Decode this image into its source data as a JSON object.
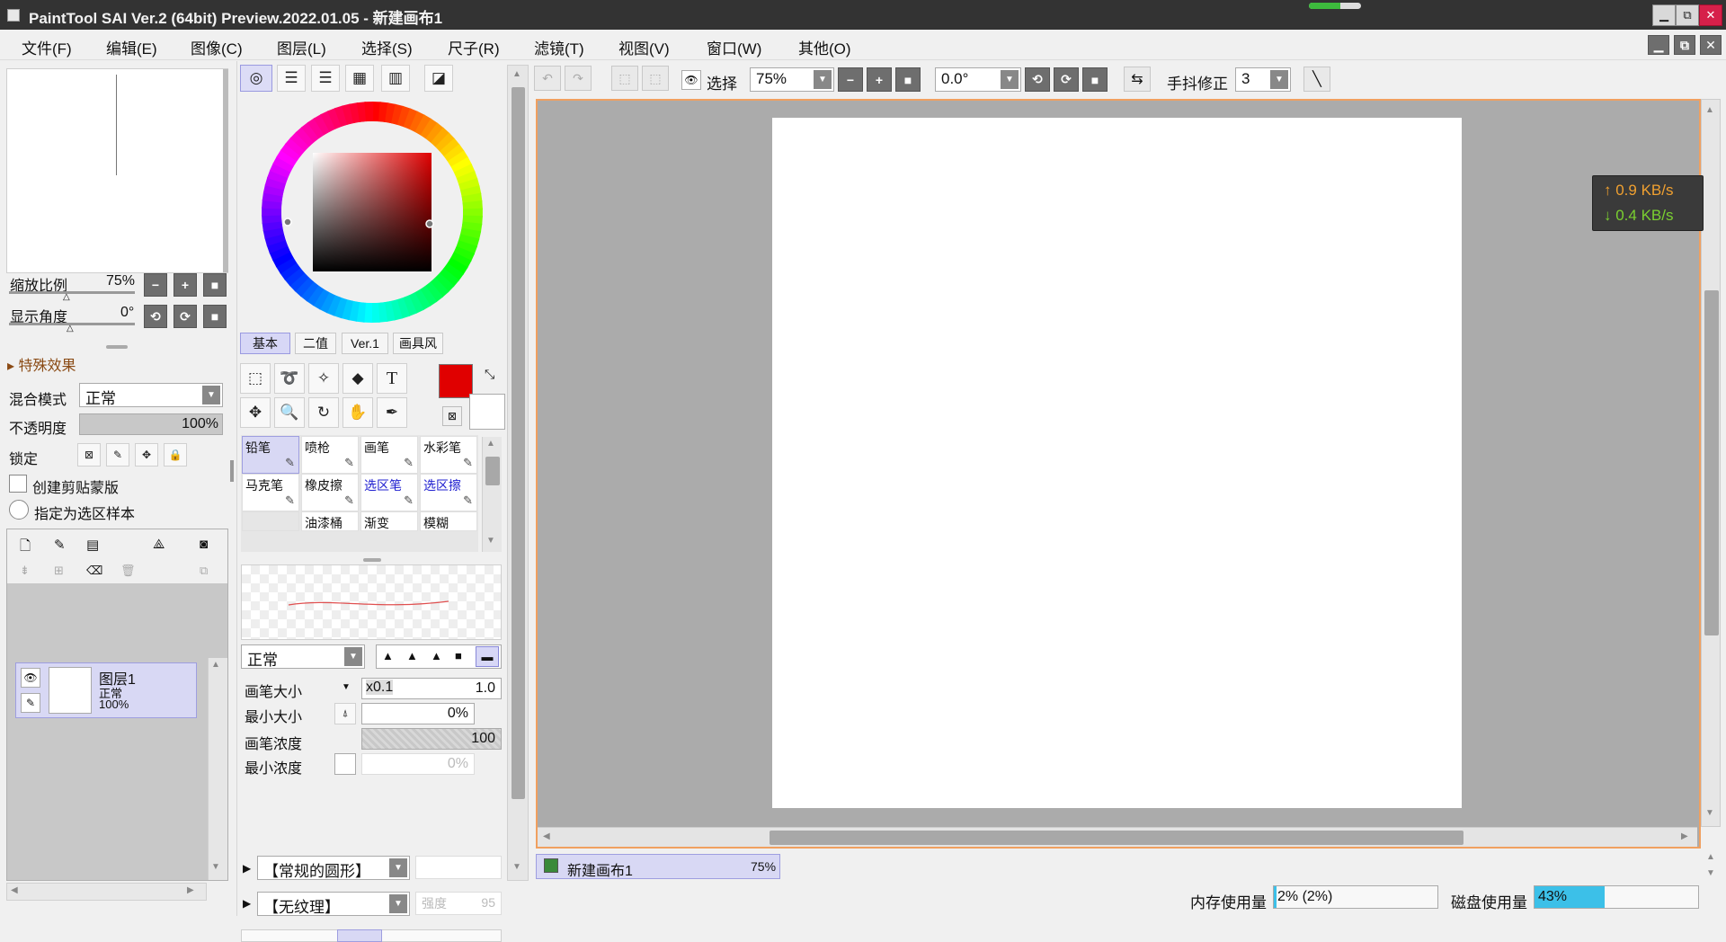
{
  "window": {
    "title": "PaintTool SAI Ver.2 (64bit) Preview.2022.01.05 - 新建画布1",
    "min_label": "▁",
    "max_label": "⧉",
    "close_label": "✕"
  },
  "menu": [
    "文件(F)",
    "编辑(E)",
    "图像(C)",
    "图层(L)",
    "选择(S)",
    "尺子(R)",
    "滤镜(T)",
    "视图(V)",
    "窗口(W)",
    "其他(O)"
  ],
  "navigator": {
    "zoom_label": "缩放比例",
    "zoom_value": "75%",
    "angle_label": "显示角度",
    "angle_value": "0°"
  },
  "layer_props": {
    "effects_label": "特殊效果",
    "blend_label": "混合模式",
    "blend_value": "正常",
    "opacity_label": "不透明度",
    "opacity_value": "100%",
    "lock_label": "锁定",
    "clip_label": "创建剪贴蒙版",
    "selection_source_label": "指定为选区样本"
  },
  "layer": {
    "name": "图层1",
    "mode": "正常",
    "opacity": "100%"
  },
  "color_tabs": [
    "基本",
    "二值",
    "Ver.1",
    "画具风"
  ],
  "colors": {
    "primary": "#e00000",
    "secondary": "#ffffff",
    "accent_selected": "#d7d7f6"
  },
  "brushes": [
    {
      "name": "铅笔",
      "icon": "pencil-icon",
      "selected": true,
      "color": "#111"
    },
    {
      "name": "喷枪",
      "icon": "airbrush-icon",
      "selected": false,
      "color": "#111"
    },
    {
      "name": "画笔",
      "icon": "brush-icon",
      "selected": false,
      "color": "#111"
    },
    {
      "name": "水彩笔",
      "icon": "watercolor-icon",
      "selected": false,
      "color": "#111"
    },
    {
      "name": "马克笔",
      "icon": "marker-icon",
      "selected": false,
      "color": "#111"
    },
    {
      "name": "橡皮擦",
      "icon": "eraser-icon",
      "selected": false,
      "color": "#111"
    },
    {
      "name": "选区笔",
      "icon": "selection-pen-icon",
      "selected": false,
      "color": "#2020d0"
    },
    {
      "name": "选区擦",
      "icon": "selection-eraser-icon",
      "selected": false,
      "color": "#2020d0"
    },
    {
      "name": "",
      "icon": "",
      "selected": false,
      "color": "#111"
    },
    {
      "name": "油漆桶",
      "icon": "",
      "selected": false,
      "color": "#111"
    },
    {
      "name": "渐变",
      "icon": "",
      "selected": false,
      "color": "#111"
    },
    {
      "name": "模糊",
      "icon": "",
      "selected": false,
      "color": "#111"
    }
  ],
  "brush_settings": {
    "mode": "正常",
    "size_label": "画笔大小",
    "size_mult": "x0.1",
    "size_value": "1.0",
    "min_size_label": "最小大小",
    "min_size_value": "0%",
    "density_label": "画笔浓度",
    "density_value": "100",
    "min_density_label": "最小浓度",
    "min_density_value": "0%",
    "shape_value": "【常规的圆形】",
    "texture_value": "【无纹理】",
    "strength_label": "强度",
    "strength_value": "95"
  },
  "toolbar": {
    "select_label": "选择",
    "zoom_value": "75%",
    "angle_value": "0.0°",
    "stabilizer_label": "手抖修正",
    "stabilizer_value": "3"
  },
  "network": {
    "up": "↑ 0.9 KB/s",
    "down": "↓ 0.4 KB/s"
  },
  "canvas_tab": {
    "name": "新建画布1",
    "zoom": "75%"
  },
  "status": {
    "memory_label": "内存使用量",
    "memory_value": "2% (2%)",
    "disk_label": "磁盘使用量",
    "disk_value": "43%",
    "disk_fraction": 0.43
  }
}
